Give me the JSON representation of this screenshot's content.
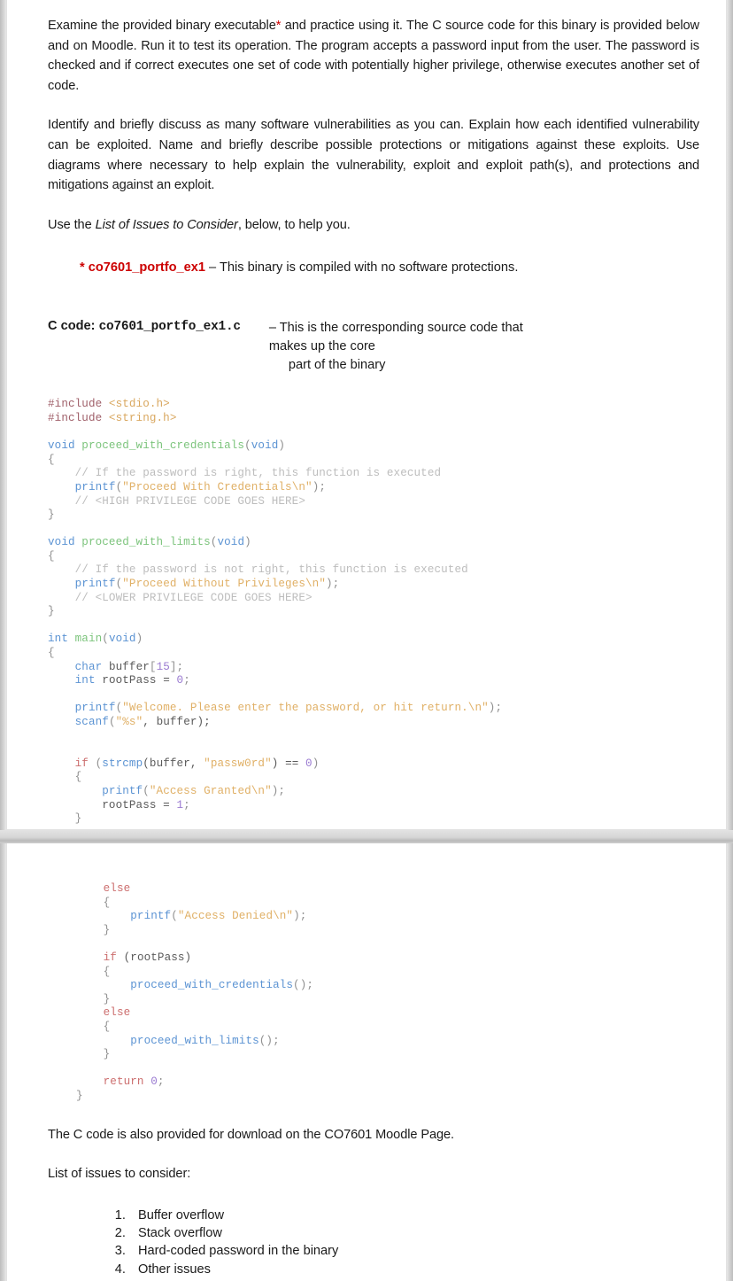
{
  "document": {
    "page1": {
      "paragraphs": [
        {
          "id": "intro",
          "segments": [
            {
              "text": "Examine the provided binary executable"
            },
            {
              "text": "*",
              "style": "asterisk"
            },
            {
              "text": " and practice using it.  The C source code for this binary is provided below and on Moodle.  Run it to test its operation.  The program accepts a password input from the user. The password is checked and if correct executes one set of code with potentially higher privilege, otherwise executes another set of code."
            }
          ]
        },
        {
          "id": "task",
          "segments": [
            {
              "text": "Identify and briefly discuss as many software vulnerabilities as you can.  Explain how each identified vulnerability can be exploited.  Name and briefly describe possible protections or mitigations against these exploits.  Use diagrams where necessary to help explain the vulnerability, exploit and exploit path(s), and protections and mitigations against an exploit."
            }
          ]
        },
        {
          "id": "use-list",
          "segments": [
            {
              "text": "Use the "
            },
            {
              "text": "List of Issues to Consider",
              "style": "italic"
            },
            {
              "text": ", below, to help you."
            }
          ]
        }
      ],
      "footnote": {
        "asterisk": "*",
        "binary_name": "co7601_portfo_ex1",
        "description": " – This binary is compiled with no software protections."
      },
      "code_heading": {
        "label": "C code: ",
        "filename": "co7601_portfo_ex1.c",
        "desc_line1": "– This is the corresponding source code that makes up the core",
        "desc_line2": "part of the binary"
      },
      "code_lines": [
        [
          {
            "t": "#include ",
            "c": "k-pre"
          },
          {
            "t": "<stdio.h>",
            "c": "k-hdr"
          }
        ],
        [
          {
            "t": "#include ",
            "c": "k-pre"
          },
          {
            "t": "<string.h>",
            "c": "k-hdr"
          }
        ],
        [
          {
            "t": "",
            "c": "k-id"
          }
        ],
        [
          {
            "t": "void ",
            "c": "k-type"
          },
          {
            "t": "proceed_with_credentials",
            "c": "k-fndef"
          },
          {
            "t": "(",
            "c": "k-punc"
          },
          {
            "t": "void",
            "c": "k-type"
          },
          {
            "t": ")",
            "c": "k-punc"
          }
        ],
        [
          {
            "t": "{",
            "c": "k-punc"
          }
        ],
        [
          {
            "t": "    // If the password is right, this function is executed",
            "c": "k-cmt"
          }
        ],
        [
          {
            "t": "    ",
            "c": "k-id"
          },
          {
            "t": "printf",
            "c": "k-fn"
          },
          {
            "t": "(",
            "c": "k-punc"
          },
          {
            "t": "\"Proceed With Credentials\\n\"",
            "c": "k-str"
          },
          {
            "t": ");",
            "c": "k-punc"
          }
        ],
        [
          {
            "t": "    // <HIGH PRIVILEGE CODE GOES HERE>",
            "c": "k-cmt"
          }
        ],
        [
          {
            "t": "}",
            "c": "k-punc"
          }
        ],
        [
          {
            "t": "",
            "c": "k-id"
          }
        ],
        [
          {
            "t": "void ",
            "c": "k-type"
          },
          {
            "t": "proceed_with_limits",
            "c": "k-fndef"
          },
          {
            "t": "(",
            "c": "k-punc"
          },
          {
            "t": "void",
            "c": "k-type"
          },
          {
            "t": ")",
            "c": "k-punc"
          }
        ],
        [
          {
            "t": "{",
            "c": "k-punc"
          }
        ],
        [
          {
            "t": "    // If the password is not right, this function is executed",
            "c": "k-cmt"
          }
        ],
        [
          {
            "t": "    ",
            "c": "k-id"
          },
          {
            "t": "printf",
            "c": "k-fn"
          },
          {
            "t": "(",
            "c": "k-punc"
          },
          {
            "t": "\"Proceed Without Privileges\\n\"",
            "c": "k-str"
          },
          {
            "t": ");",
            "c": "k-punc"
          }
        ],
        [
          {
            "t": "    // <LOWER PRIVILEGE CODE GOES HERE>",
            "c": "k-cmt"
          }
        ],
        [
          {
            "t": "}",
            "c": "k-punc"
          }
        ],
        [
          {
            "t": "",
            "c": "k-id"
          }
        ],
        [
          {
            "t": "int ",
            "c": "k-type"
          },
          {
            "t": "main",
            "c": "k-fndef"
          },
          {
            "t": "(",
            "c": "k-punc"
          },
          {
            "t": "void",
            "c": "k-type"
          },
          {
            "t": ")",
            "c": "k-punc"
          }
        ],
        [
          {
            "t": "{",
            "c": "k-punc"
          }
        ],
        [
          {
            "t": "    ",
            "c": "k-id"
          },
          {
            "t": "char ",
            "c": "k-type"
          },
          {
            "t": "buffer",
            "c": "k-id"
          },
          {
            "t": "[",
            "c": "k-punc"
          },
          {
            "t": "15",
            "c": "k-num"
          },
          {
            "t": "];",
            "c": "k-punc"
          }
        ],
        [
          {
            "t": "    ",
            "c": "k-id"
          },
          {
            "t": "int ",
            "c": "k-type"
          },
          {
            "t": "rootPass = ",
            "c": "k-id"
          },
          {
            "t": "0",
            "c": "k-num"
          },
          {
            "t": ";",
            "c": "k-punc"
          }
        ],
        [
          {
            "t": "",
            "c": "k-id"
          }
        ],
        [
          {
            "t": "    ",
            "c": "k-id"
          },
          {
            "t": "printf",
            "c": "k-fn"
          },
          {
            "t": "(",
            "c": "k-punc"
          },
          {
            "t": "\"Welcome. Please enter the password, or hit return.\\n\"",
            "c": "k-str"
          },
          {
            "t": ");",
            "c": "k-punc"
          }
        ],
        [
          {
            "t": "    ",
            "c": "k-id"
          },
          {
            "t": "scanf",
            "c": "k-fn"
          },
          {
            "t": "(",
            "c": "k-punc"
          },
          {
            "t": "\"%s\"",
            "c": "k-str"
          },
          {
            "t": ", buffer);",
            "c": "k-id"
          }
        ],
        [
          {
            "t": "",
            "c": "k-id"
          }
        ],
        [
          {
            "t": "",
            "c": "k-id"
          }
        ],
        [
          {
            "t": "    ",
            "c": "k-id"
          },
          {
            "t": "if",
            "c": "k-kw"
          },
          {
            "t": " (",
            "c": "k-punc"
          },
          {
            "t": "strcmp",
            "c": "k-fn"
          },
          {
            "t": "(buffer, ",
            "c": "k-id"
          },
          {
            "t": "\"passw0rd\"",
            "c": "k-str"
          },
          {
            "t": ") == ",
            "c": "k-id"
          },
          {
            "t": "0",
            "c": "k-num"
          },
          {
            "t": ")",
            "c": "k-punc"
          }
        ],
        [
          {
            "t": "    {",
            "c": "k-punc"
          }
        ],
        [
          {
            "t": "        ",
            "c": "k-id"
          },
          {
            "t": "printf",
            "c": "k-fn"
          },
          {
            "t": "(",
            "c": "k-punc"
          },
          {
            "t": "\"Access Granted\\n\"",
            "c": "k-str"
          },
          {
            "t": ");",
            "c": "k-punc"
          }
        ],
        [
          {
            "t": "        rootPass = ",
            "c": "k-id"
          },
          {
            "t": "1",
            "c": "k-num"
          },
          {
            "t": ";",
            "c": "k-punc"
          }
        ],
        [
          {
            "t": "    }",
            "c": "k-punc"
          }
        ]
      ]
    },
    "page2": {
      "code_lines": [
        [
          {
            "t": "    ",
            "c": "k-id"
          },
          {
            "t": "else",
            "c": "k-kw"
          }
        ],
        [
          {
            "t": "    {",
            "c": "k-punc"
          }
        ],
        [
          {
            "t": "        ",
            "c": "k-id"
          },
          {
            "t": "printf",
            "c": "k-fn"
          },
          {
            "t": "(",
            "c": "k-punc"
          },
          {
            "t": "\"Access Denied\\n\"",
            "c": "k-str"
          },
          {
            "t": ");",
            "c": "k-punc"
          }
        ],
        [
          {
            "t": "    }",
            "c": "k-punc"
          }
        ],
        [
          {
            "t": "",
            "c": "k-id"
          }
        ],
        [
          {
            "t": "    ",
            "c": "k-id"
          },
          {
            "t": "if",
            "c": "k-kw"
          },
          {
            "t": " (rootPass)",
            "c": "k-id"
          }
        ],
        [
          {
            "t": "    {",
            "c": "k-punc"
          }
        ],
        [
          {
            "t": "        ",
            "c": "k-id"
          },
          {
            "t": "proceed_with_credentials",
            "c": "k-fn"
          },
          {
            "t": "();",
            "c": "k-punc"
          }
        ],
        [
          {
            "t": "    }",
            "c": "k-punc"
          }
        ],
        [
          {
            "t": "    ",
            "c": "k-id"
          },
          {
            "t": "else",
            "c": "k-kw"
          }
        ],
        [
          {
            "t": "    {",
            "c": "k-punc"
          }
        ],
        [
          {
            "t": "        ",
            "c": "k-id"
          },
          {
            "t": "proceed_with_limits",
            "c": "k-fn"
          },
          {
            "t": "();",
            "c": "k-punc"
          }
        ],
        [
          {
            "t": "    }",
            "c": "k-punc"
          }
        ],
        [
          {
            "t": "",
            "c": "k-id"
          }
        ],
        [
          {
            "t": "    ",
            "c": "k-id"
          },
          {
            "t": "return ",
            "c": "k-kw"
          },
          {
            "t": "0",
            "c": "k-num"
          },
          {
            "t": ";",
            "c": "k-punc"
          }
        ],
        [
          {
            "t": "}",
            "c": "k-punc"
          }
        ]
      ],
      "download_note": "The C code is also provided for download on the CO7601 Moodle Page.",
      "list_intro": "List of issues to consider:",
      "issues": [
        "Buffer overflow",
        "Stack overflow",
        "Hard-coded password in the binary",
        "Other issues"
      ]
    }
  },
  "colors": {
    "accent_red": "#cc0000",
    "page_background": "#ffffff",
    "viewer_background": "#e8e8e8"
  }
}
